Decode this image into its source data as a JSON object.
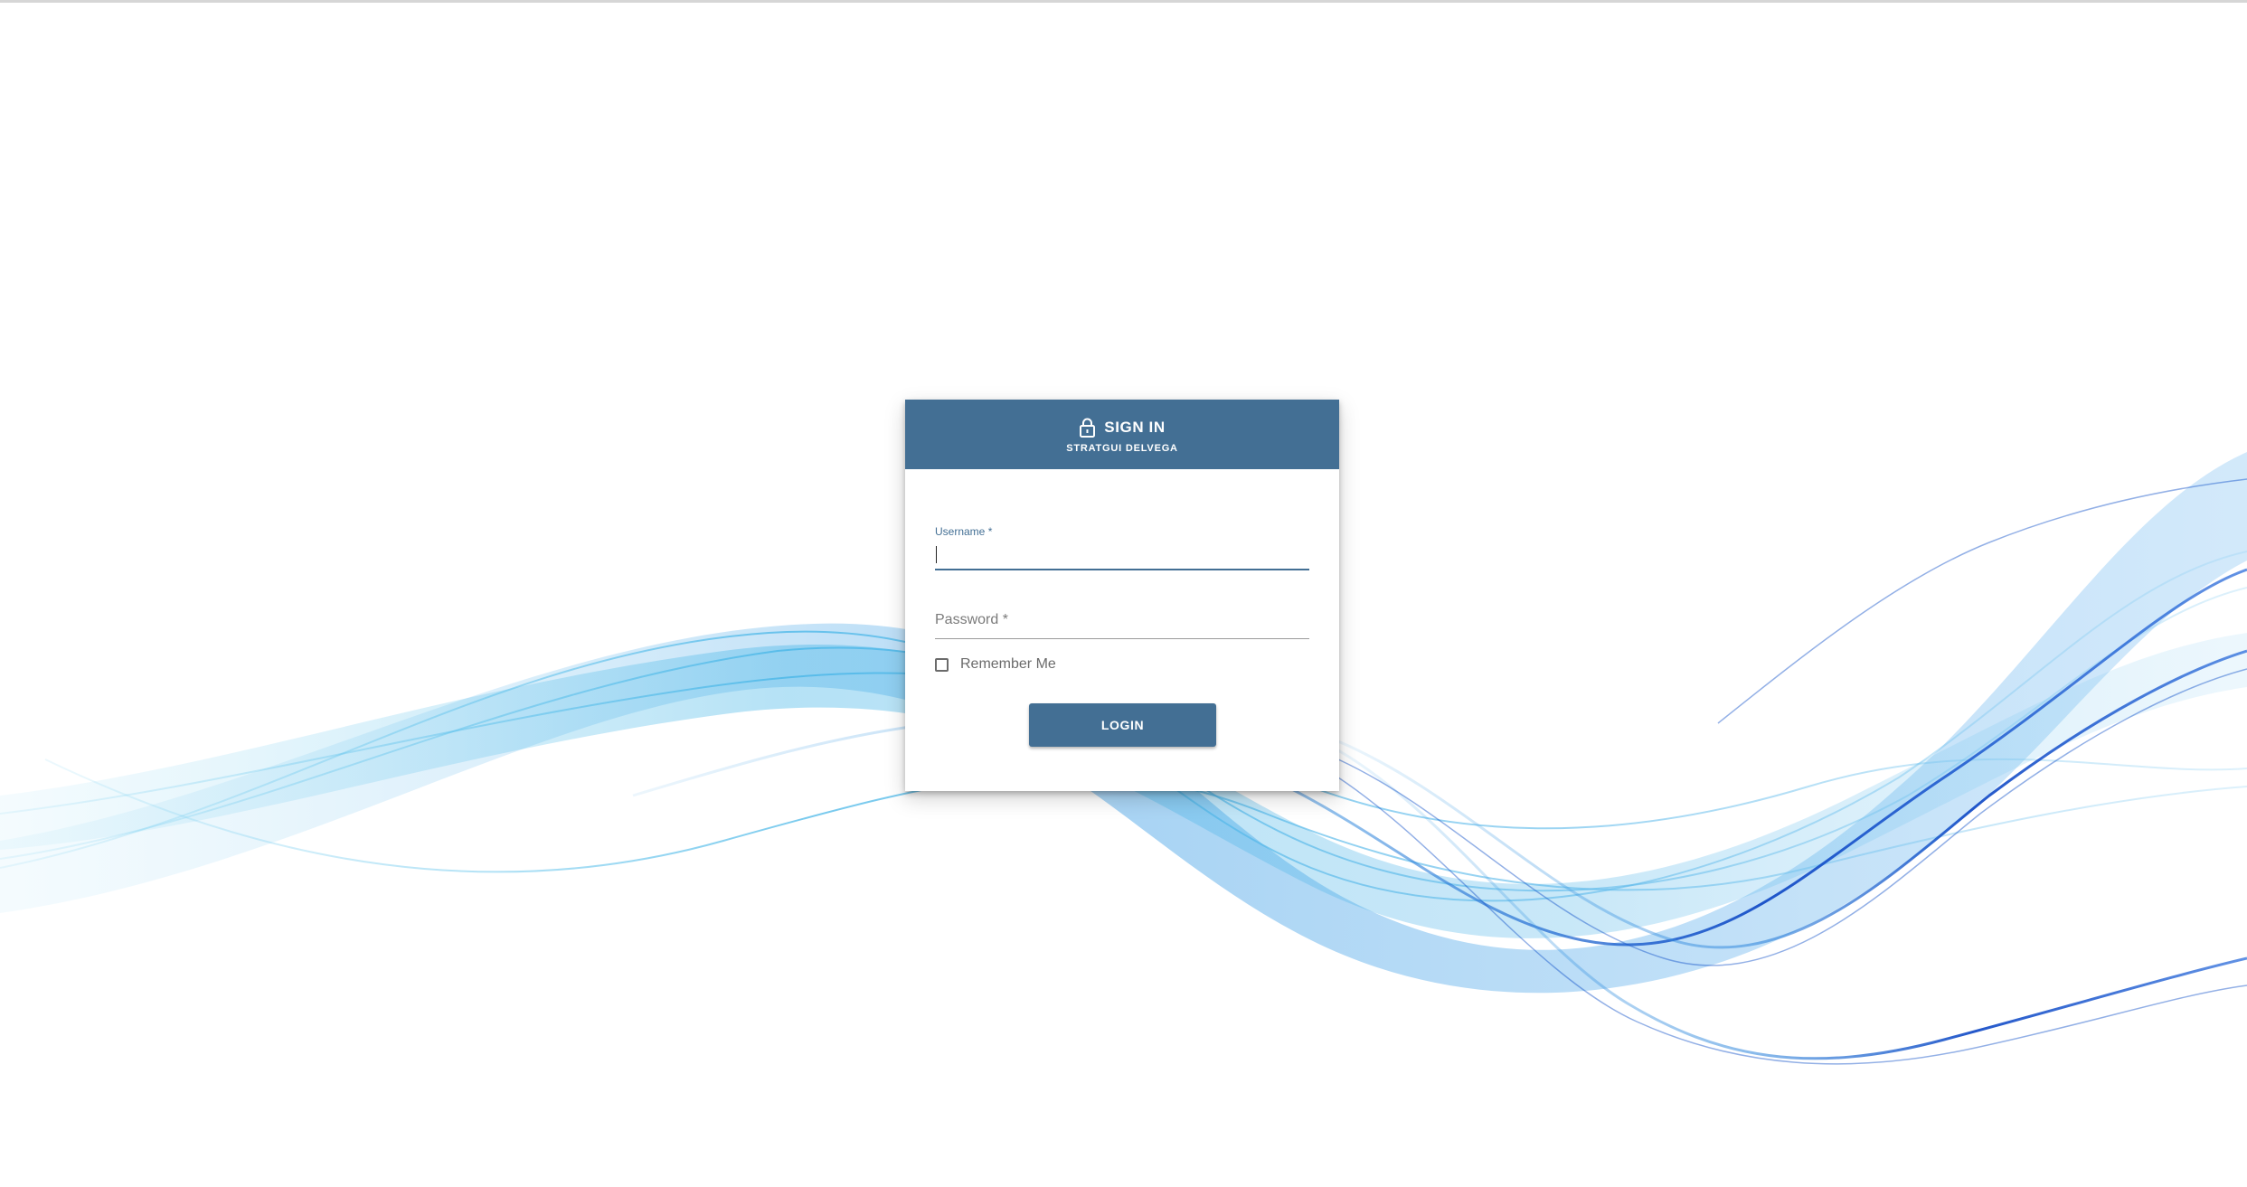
{
  "header": {
    "title": "SIGN IN",
    "subtitle": "STRATGUI DELVEGA",
    "icon": "lock-icon"
  },
  "form": {
    "username": {
      "label": "Username *",
      "value": ""
    },
    "password": {
      "label": "Password *",
      "value": ""
    },
    "remember_me": {
      "label": "Remember Me",
      "checked": false
    },
    "login_button_label": "LOGIN"
  },
  "colors": {
    "primary": "#436f94",
    "background": "#ffffff",
    "wave_light": "#5fc3ea",
    "wave_dark": "#1a5fd0"
  }
}
